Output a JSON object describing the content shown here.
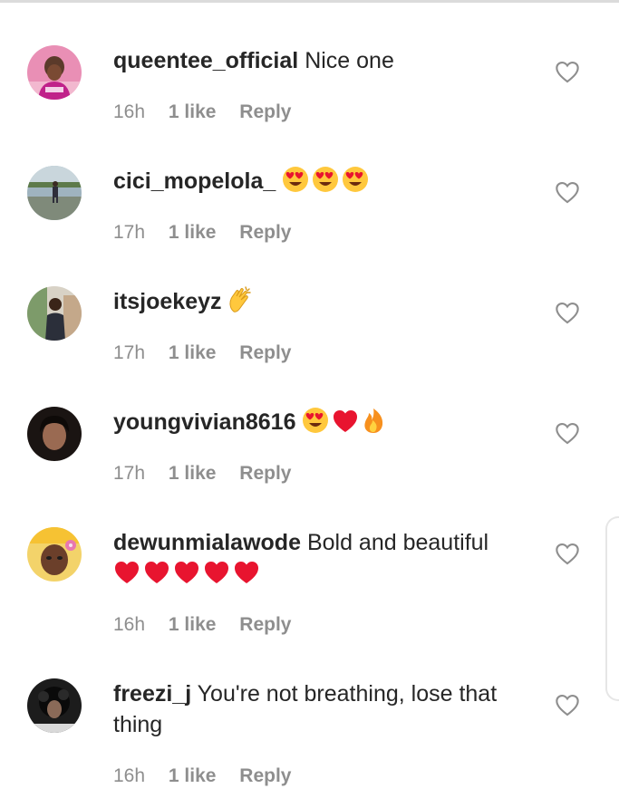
{
  "colors": {
    "text": "#262626",
    "meta": "#8e8e8e",
    "heart_outline": "#8e8e8e",
    "emoji_red": "#e8142f",
    "emoji_yellow": "#ffc83d"
  },
  "comments": [
    {
      "username": "queentee_official",
      "message": "Nice one",
      "time": "16h",
      "likes": "1 like",
      "reply": "Reply",
      "emojis": []
    },
    {
      "username": "cici_mopelola_",
      "message": "",
      "time": "17h",
      "likes": "1 like",
      "reply": "Reply",
      "emojis": [
        "heart-eyes-emoji",
        "heart-eyes-emoji",
        "heart-eyes-emoji"
      ]
    },
    {
      "username": "itsjoekeyz",
      "message": "",
      "time": "17h",
      "likes": "1 like",
      "reply": "Reply",
      "emojis": [
        "clapping-hands-emoji"
      ]
    },
    {
      "username": "youngvivian8616",
      "message": "",
      "time": "17h",
      "likes": "1 like",
      "reply": "Reply",
      "emojis": [
        "heart-eyes-emoji",
        "red-heart-emoji",
        "fire-emoji"
      ]
    },
    {
      "username": "dewunmialawode",
      "message": "Bold and beautiful",
      "time": "16h",
      "likes": "1 like",
      "reply": "Reply",
      "emojis": [
        "red-heart-emoji",
        "red-heart-emoji",
        "red-heart-emoji",
        "red-heart-emoji",
        "red-heart-emoji"
      ]
    },
    {
      "username": "freezi_j",
      "message": "You're not breathing, lose that thing",
      "time": "16h",
      "likes": "1 like",
      "reply": "Reply",
      "emojis": []
    }
  ],
  "icons": {
    "like": "heart-outline-icon"
  }
}
